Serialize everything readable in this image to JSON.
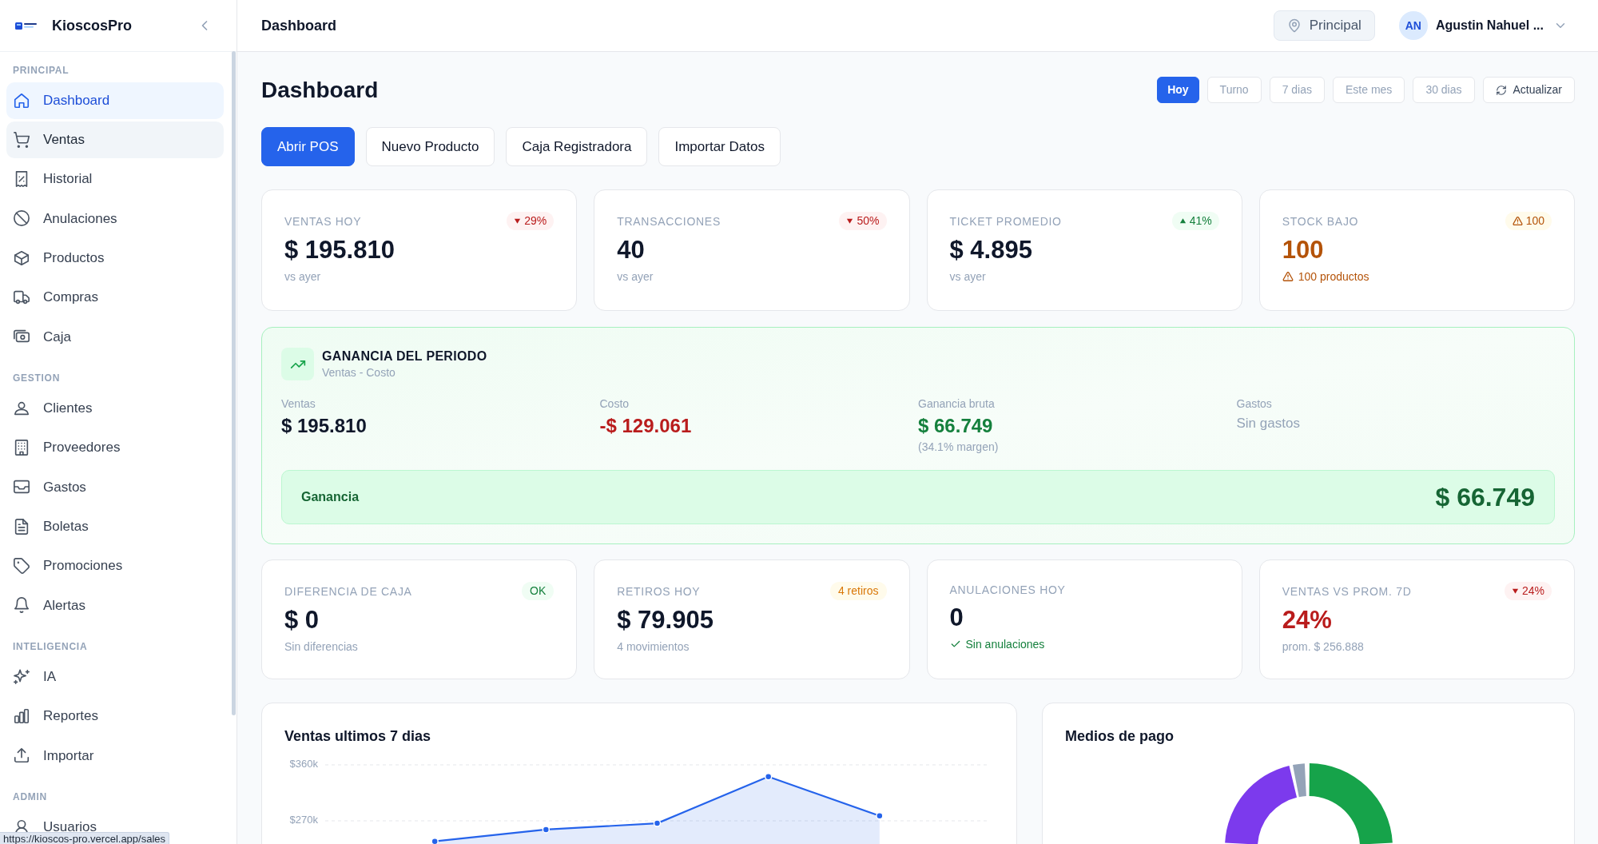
{
  "sidebar": {
    "brand": "KioscosPro",
    "sections": [
      {
        "title": "PRINCIPAL",
        "items": [
          {
            "label": "Dashboard",
            "selected": true,
            "hovered": false
          },
          {
            "label": "Ventas",
            "selected": false,
            "hovered": true
          },
          {
            "label": "Historial",
            "selected": false,
            "hovered": false
          },
          {
            "label": "Anulaciones",
            "selected": false,
            "hovered": false
          },
          {
            "label": "Productos",
            "selected": false,
            "hovered": false
          },
          {
            "label": "Compras",
            "selected": false,
            "hovered": false
          },
          {
            "label": "Caja",
            "selected": false,
            "hovered": false
          }
        ]
      },
      {
        "title": "GESTION",
        "items": [
          {
            "label": "Clientes",
            "selected": false,
            "hovered": false
          },
          {
            "label": "Proveedores",
            "selected": false,
            "hovered": false
          },
          {
            "label": "Gastos",
            "selected": false,
            "hovered": false
          },
          {
            "label": "Boletas",
            "selected": false,
            "hovered": false
          },
          {
            "label": "Promociones",
            "selected": false,
            "hovered": false
          },
          {
            "label": "Alertas",
            "selected": false,
            "hovered": false
          }
        ]
      },
      {
        "title": "INTELIGENCIA",
        "items": [
          {
            "label": "IA",
            "selected": false,
            "hovered": false
          },
          {
            "label": "Reportes",
            "selected": false,
            "hovered": false
          },
          {
            "label": "Importar",
            "selected": false,
            "hovered": false
          }
        ]
      },
      {
        "title": "ADMIN",
        "items": [
          {
            "label": "Usuarios",
            "selected": false,
            "hovered": false
          }
        ]
      }
    ]
  },
  "topbar": {
    "title": "Dashboard",
    "branch": "Principal",
    "user_initials": "AN",
    "user_name": "Agustin Nahuel ..."
  },
  "page": {
    "title": "Dashboard",
    "periods": [
      {
        "label": "Hoy",
        "selected": true
      },
      {
        "label": "Turno",
        "selected": false
      },
      {
        "label": "7 dias",
        "selected": false
      },
      {
        "label": "Este mes",
        "selected": false
      },
      {
        "label": "30 dias",
        "selected": false
      }
    ],
    "refresh": "Actualizar",
    "actions": [
      {
        "label": "Abrir POS",
        "kind": "primary"
      },
      {
        "label": "Nuevo Producto",
        "kind": "secondary"
      },
      {
        "label": "Caja Registradora",
        "kind": "secondary"
      },
      {
        "label": "Importar Datos",
        "kind": "secondary"
      }
    ]
  },
  "kpis_top": [
    {
      "label": "VENTAS HOY",
      "badge": {
        "kind": "down",
        "text": "29%"
      },
      "value": "$ 195.810",
      "color": "#0f172a",
      "note": {
        "kind": "plain",
        "text": "vs ayer"
      }
    },
    {
      "label": "TRANSACCIONES",
      "badge": {
        "kind": "down",
        "text": "50%"
      },
      "value": "40",
      "color": "#0f172a",
      "note": {
        "kind": "plain",
        "text": "vs ayer"
      }
    },
    {
      "label": "TICKET PROMEDIO",
      "badge": {
        "kind": "up",
        "text": "41%"
      },
      "value": "$ 4.895",
      "color": "#0f172a",
      "note": {
        "kind": "plain",
        "text": "vs ayer"
      }
    },
    {
      "label": "STOCK BAJO",
      "badge": {
        "kind": "warning",
        "text": "100"
      },
      "value": "100",
      "color": "#b45309",
      "note": {
        "kind": "warning",
        "text": "100 productos"
      }
    }
  ],
  "profit": {
    "title": "GANANCIA DEL PERIODO",
    "subtitle": "Ventas - Costo",
    "items": [
      {
        "label": "Ventas",
        "value": "$ 195.810",
        "kind": "neutral"
      },
      {
        "label": "Costo",
        "value": "-$ 129.061",
        "kind": "negative"
      },
      {
        "label": "Ganancia bruta",
        "value": "$ 66.749",
        "kind": "positive",
        "note": "(34.1% margen)"
      },
      {
        "label": "Gastos",
        "value": "Sin gastos",
        "kind": "empty"
      }
    ],
    "total": {
      "label": "Ganancia",
      "value": "$ 66.749"
    }
  },
  "kpis_bottom": [
    {
      "label": "DIFERENCIA DE CAJA",
      "badge": {
        "kind": "ok",
        "text": "OK"
      },
      "value": "$ 0",
      "color": "#0f172a",
      "note": {
        "kind": "plain",
        "text": "Sin diferencias"
      }
    },
    {
      "label": "RETIROS HOY",
      "badge": {
        "kind": "count",
        "text": "4 retiros"
      },
      "value": "$ 79.905",
      "color": "#0f172a",
      "note": {
        "kind": "plain",
        "text": "4 movimientos"
      }
    },
    {
      "label": "ANULACIONES HOY",
      "value": "0",
      "color": "#0f172a",
      "note": {
        "kind": "success",
        "text": "Sin anulaciones"
      }
    },
    {
      "label": "VENTAS VS PROM. 7D",
      "badge": {
        "kind": "down",
        "text": "24%"
      },
      "value": "24%",
      "color": "#b91c1c",
      "note": {
        "kind": "plain",
        "text": "prom. $ 256.888"
      }
    }
  ],
  "charts": {
    "sales": {
      "title": "Ventas ultimos 7 dias",
      "chart_data": {
        "type": "area",
        "ylim": [
          0,
          360000
        ],
        "yticks": [
          {
            "value": 270000,
            "label": "$270k"
          },
          {
            "value": 360000,
            "label": "$360k"
          }
        ],
        "series": [
          {
            "color": "#2563eb",
            "values": [
              null,
              237000,
              256000,
              266000,
              341000,
              278000,
              null
            ]
          }
        ]
      }
    },
    "payments": {
      "title": "Medios de pago"
    }
  },
  "status_url": "https://kioscos-pro.vercel.app/sales"
}
